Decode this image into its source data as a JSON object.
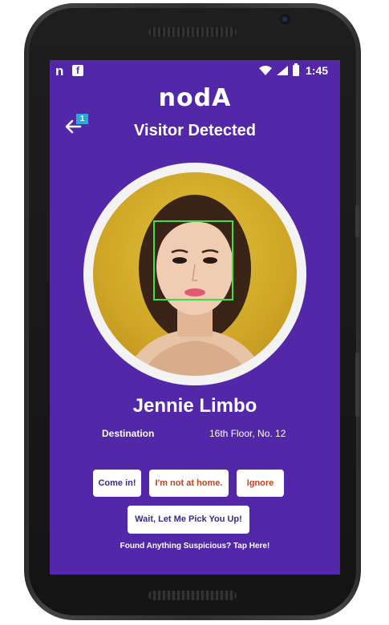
{
  "statusbar": {
    "app_glyph": "n",
    "fb_glyph": "f",
    "time": "1:45"
  },
  "header": {
    "logo": "nodA",
    "back_badge": "1",
    "title": "Visitor Detected"
  },
  "visitor": {
    "name": "Jennie Limbo",
    "destination_label": "Destination",
    "destination_value": "16th Floor, No. 12"
  },
  "actions": {
    "come_in": "Come in!",
    "not_at_home": "I'm not at home.",
    "ignore": "Ignore",
    "wait": "Wait, Let Me Pick You Up!",
    "suspicious": "Found Anything Suspicious? Tap Here!"
  },
  "colors": {
    "background": "#5228a8",
    "face_box": "#3ee040",
    "badge": "#2aa8e0",
    "accent_orange": "#c4421c",
    "accent_purple": "#3a2a8a"
  }
}
